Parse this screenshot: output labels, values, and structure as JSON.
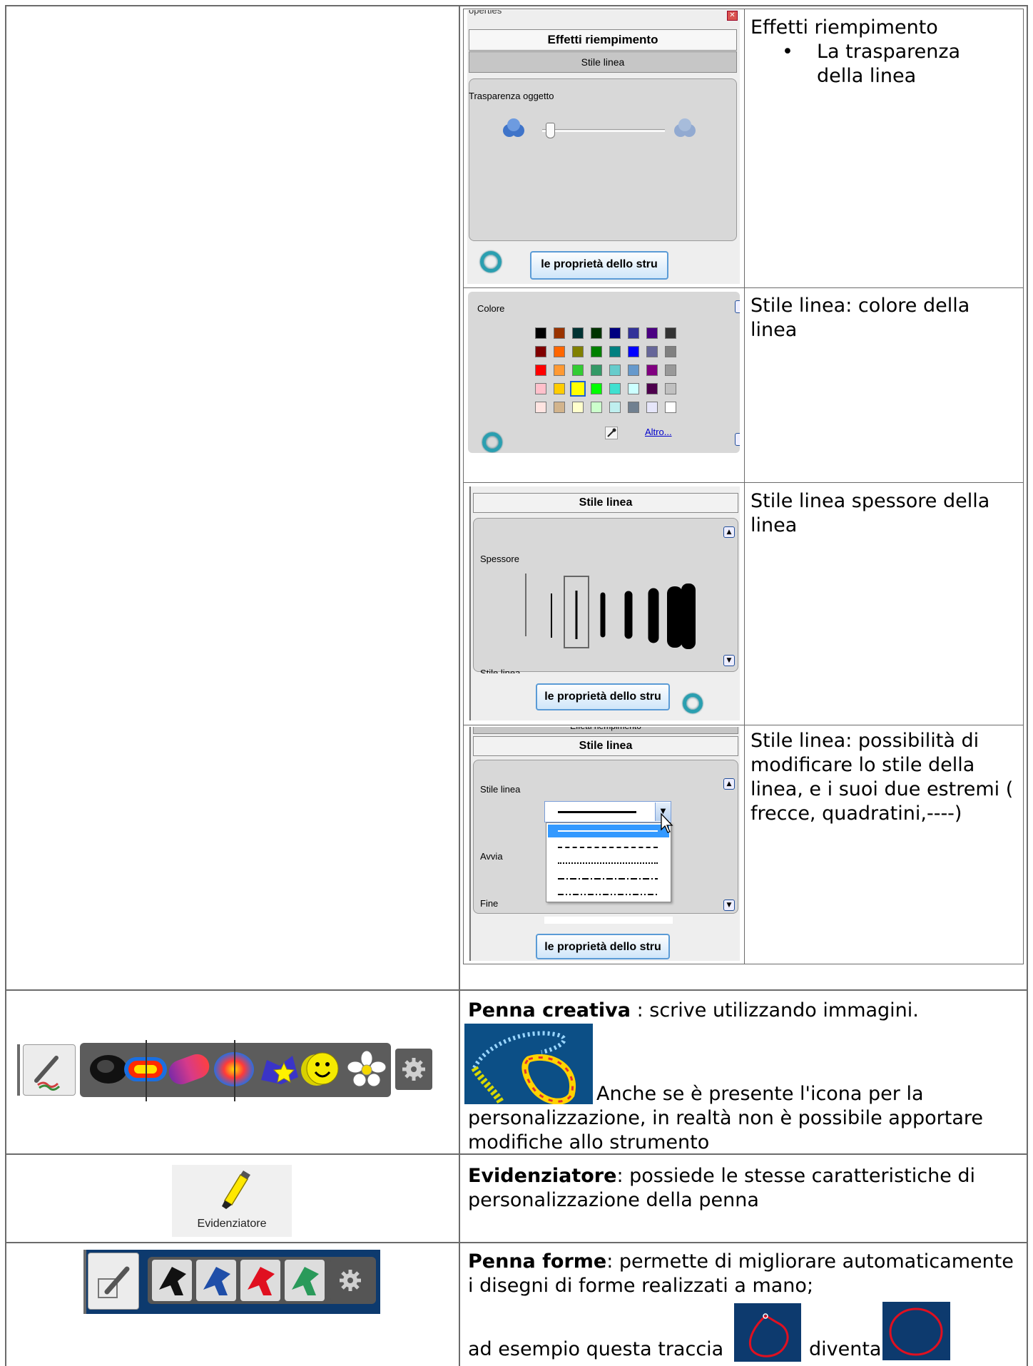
{
  "rows": [
    {
      "panel": {
        "window_title": "operties",
        "tab_effects": "Effetti riempimento",
        "tab_line_style": "Stile linea",
        "transparency_label": "Trasparenza oggetto",
        "transparency_value": 0.03,
        "tool_button": "le proprietà dello stru"
      },
      "description_title": "Effetti riempimento",
      "description_bullet": "La trasparenza della linea"
    },
    {
      "panel": {
        "color_label": "Colore",
        "more_link": "Altro...",
        "selected_color": "#ffff00",
        "colors": [
          [
            "#000000",
            "#993300",
            "#003333",
            "#003300",
            "#000080",
            "#333399",
            "#4b0082",
            "#333333"
          ],
          [
            "#800000",
            "#ff6600",
            "#808000",
            "#008000",
            "#008080",
            "#0000ff",
            "#666699",
            "#808080"
          ],
          [
            "#ff0000",
            "#ff9933",
            "#33cc33",
            "#339966",
            "#66cccc",
            "#6699cc",
            "#800080",
            "#999999"
          ],
          [
            "#ffc0cb",
            "#ffcc00",
            "#ffff00",
            "#00ff00",
            "#40e0d0",
            "#ccffff",
            "#4d004d",
            "#c0c0c0"
          ],
          [
            "#ffe4e1",
            "#d2b48c",
            "#ffffcc",
            "#ccffcc",
            "#bfefef",
            "#708090",
            "#e6e6fa",
            "#ffffff"
          ]
        ]
      },
      "description": "Stile linea: colore della linea"
    },
    {
      "panel": {
        "tab_line_style": "Stile linea",
        "thickness_label": "Spessore",
        "line_style_label": "Stile linea",
        "tool_button": "le proprietà dello stru"
      },
      "description": "Stile linea spessore della linea"
    },
    {
      "panel": {
        "tab_effects": "Effetti riempimento",
        "tab_line_style": "Stile linea",
        "line_style_label": "Stile linea",
        "start_label": "Avvia",
        "end_label": "Fine",
        "tool_button": "le proprietà dello stru"
      },
      "description": "Stile linea: possibilità di modificare lo stile della linea, e i suoi due estremi ( frecce, quadratini,----)"
    }
  ],
  "creative_pen": {
    "title": "Penna creativa",
    "title_rest": " : scrive utilizzando immagini.",
    "note": "Anche se è presente l'icona per la personalizzazione, in realtà non è possibile apportare modifiche allo strumento"
  },
  "highlighter": {
    "icon_label": "Evidenziatore",
    "title": "Evidenziatore",
    "text": ": possiede le stesse caratteristiche di personalizzazione della penna"
  },
  "shape_pen": {
    "title": "Penna forme",
    "text": ":  permette di migliorare automaticamente i disegni di forme realizzati a mano;",
    "example_prefix": "ad esempio questa traccia",
    "example_suffix": "diventa"
  },
  "colors": {
    "panel_gray": "#d8d8d8",
    "dark_blue": "#0d3a6e",
    "button_blue": "#5a9bd6",
    "link_blue": "#0000cc"
  }
}
